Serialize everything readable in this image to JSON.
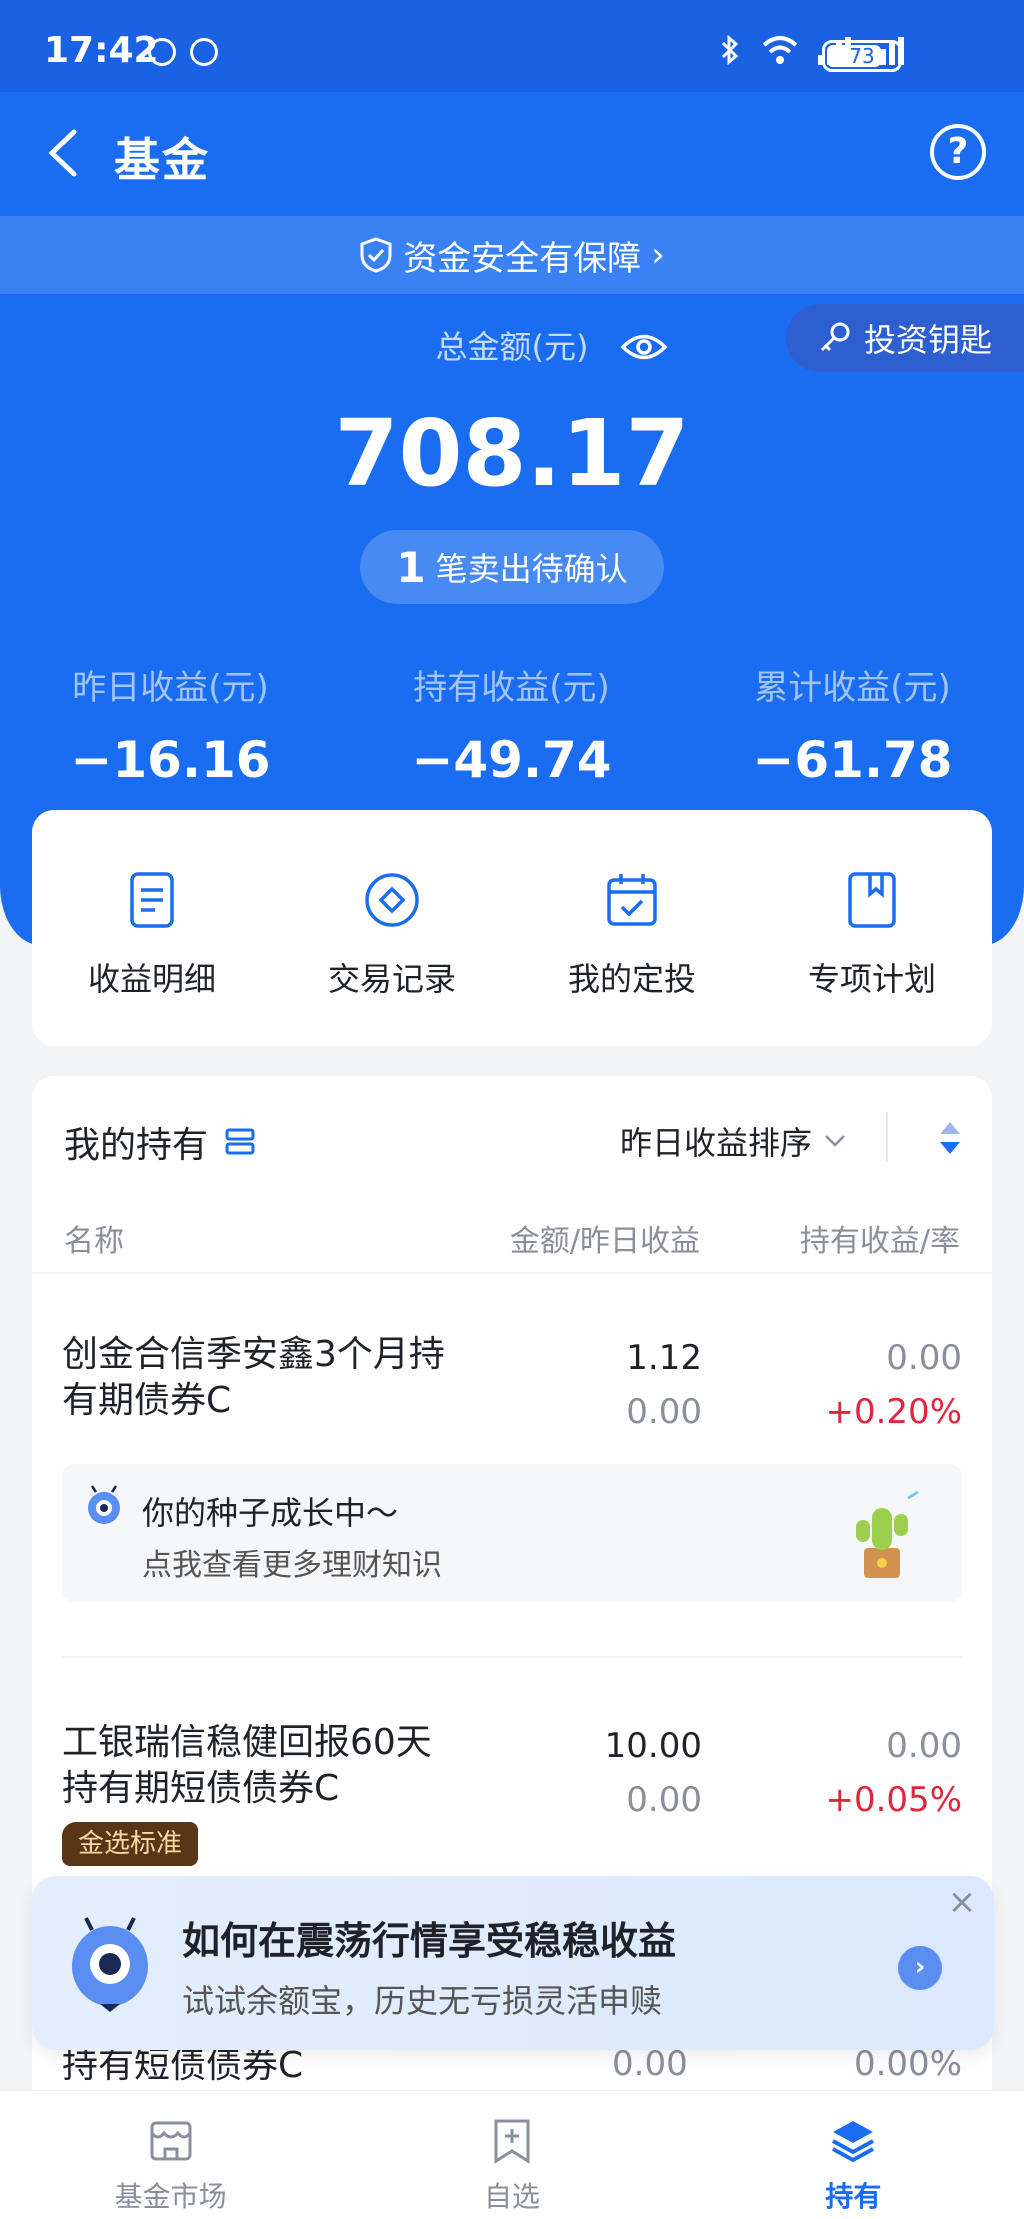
{
  "status_bar": {
    "time": "17:42",
    "battery": "73"
  },
  "nav": {
    "title": "基金"
  },
  "safety_banner": {
    "text": "资金安全有保障",
    "arrow": "›"
  },
  "key_button": {
    "label": "投资钥匙"
  },
  "summary": {
    "total_label": "总金额(元)",
    "total_value": "708.17",
    "pending_count": "1",
    "pending_text": "笔卖出待确认",
    "stats": [
      {
        "label": "昨日收益(元)",
        "value": "−16.16"
      },
      {
        "label": "持有收益(元)",
        "value": "−49.74"
      },
      {
        "label": "累计收益(元)",
        "value": "−61.78"
      }
    ]
  },
  "actions": [
    {
      "label": "收益明细",
      "icon": "document-icon"
    },
    {
      "label": "交易记录",
      "icon": "diamond-circle-icon"
    },
    {
      "label": "我的定投",
      "icon": "calendar-check-icon"
    },
    {
      "label": "专项计划",
      "icon": "bookmark-icon"
    }
  ],
  "holdings": {
    "title": "我的持有",
    "sort_label": "昨日收益排序",
    "columns": {
      "name": "名称",
      "amount": "金额/昨日收益",
      "profit": "持有收益/率"
    },
    "funds": [
      {
        "name": "创金合信季安鑫3个月持有期债券C",
        "amount": "1.12",
        "yesterday": "0.00",
        "profit": "0.00",
        "rate": "+0.20%"
      },
      {
        "name": "工银瑞信稳健回报60天持有期短债债券C",
        "amount": "10.00",
        "yesterday": "0.00",
        "profit": "0.00",
        "rate": "+0.05%",
        "badge": "金选标准"
      }
    ],
    "seed_tip": {
      "title": "你的种子成长中～",
      "subtitle": "点我查看更多理财知识"
    },
    "tail_row": {
      "name": "持有短债债券C",
      "amount": "0.00",
      "profit": "0.00%"
    }
  },
  "promo": {
    "title": "如何在震荡行情享受稳稳收益",
    "subtitle": "试试余额宝，历史无亏损灵活申赎",
    "close": "×"
  },
  "tabbar": [
    {
      "label": "基金市场",
      "icon": "store-icon"
    },
    {
      "label": "自选",
      "icon": "add-bookmark-icon"
    },
    {
      "label": "持有",
      "icon": "layers-icon"
    }
  ],
  "colors": {
    "primary": "#1a6df1",
    "negative": "#e0263e",
    "badge_bg": "#5a3616"
  }
}
